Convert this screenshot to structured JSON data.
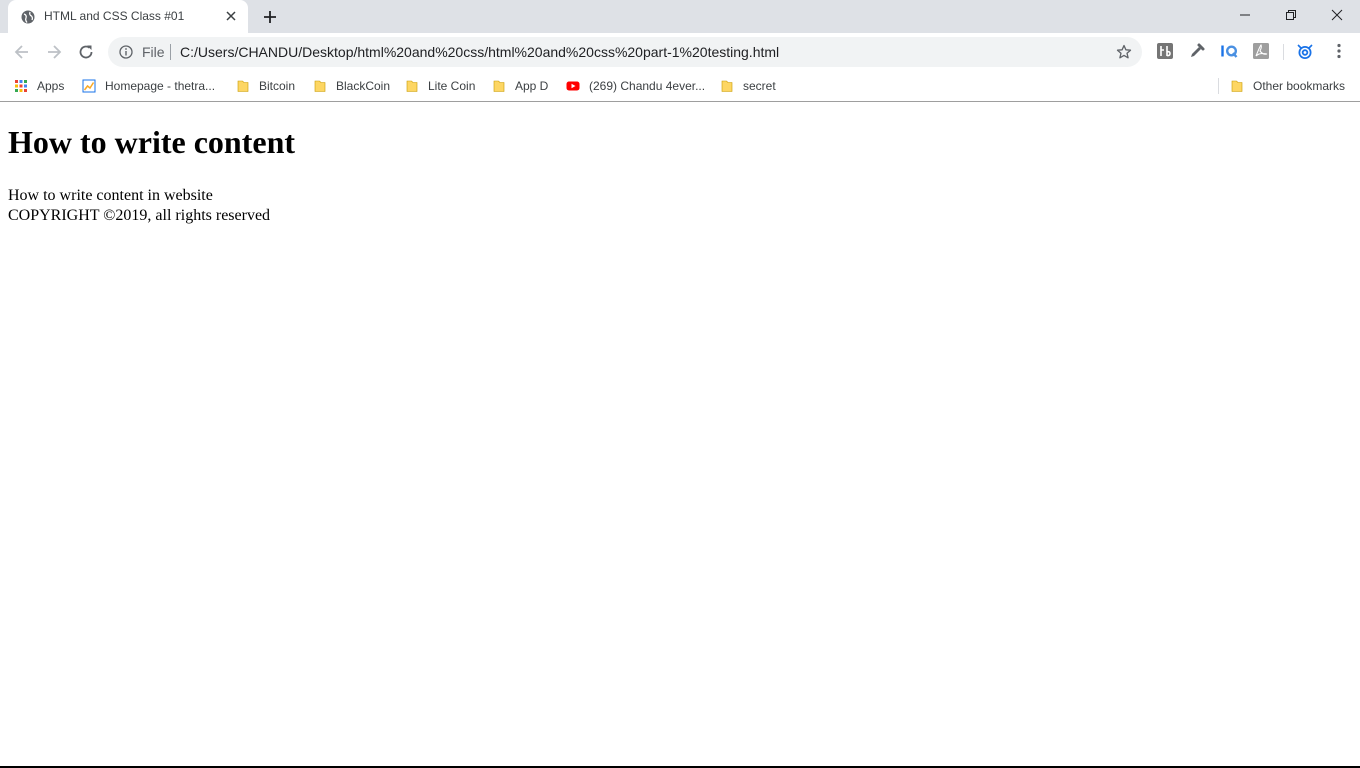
{
  "tab": {
    "title": "HTML and CSS Class #01"
  },
  "address_bar": {
    "scheme_label": "File",
    "url": "C:/Users/CHANDU/Desktop/html%20and%20css/html%20and%20css%20part-1%20testing.html"
  },
  "extensions": [
    "toolbox-icon",
    "eyedropper-icon",
    "iq-icon",
    "pdf-icon",
    "cloud-extension-icon"
  ],
  "bookmarks": [
    {
      "label": "Apps",
      "icon": "apps-grid-icon"
    },
    {
      "label": "Homepage - thetra...",
      "icon": "chart-favicon-icon"
    },
    {
      "label": "Bitcoin",
      "icon": "folder-icon"
    },
    {
      "label": "BlackCoin",
      "icon": "folder-icon"
    },
    {
      "label": "Lite Coin",
      "icon": "folder-icon"
    },
    {
      "label": "App D",
      "icon": "folder-icon"
    },
    {
      "label": "(269) Chandu 4ever...",
      "icon": "youtube-icon"
    },
    {
      "label": "secret",
      "icon": "folder-icon"
    }
  ],
  "other_bookmarks": {
    "label": "Other bookmarks"
  },
  "page": {
    "heading": "How to write content",
    "paragraph": "How to write content in website",
    "footer": "COPYRIGHT ©2019, all rights reserved"
  },
  "colors": {
    "tabstrip_bg": "#dee1e6",
    "omnibox_bg": "#f1f3f4",
    "folder_yellow": "#fdd663",
    "youtube_red": "#ff0000",
    "extension_blue": "#1a73e8"
  }
}
